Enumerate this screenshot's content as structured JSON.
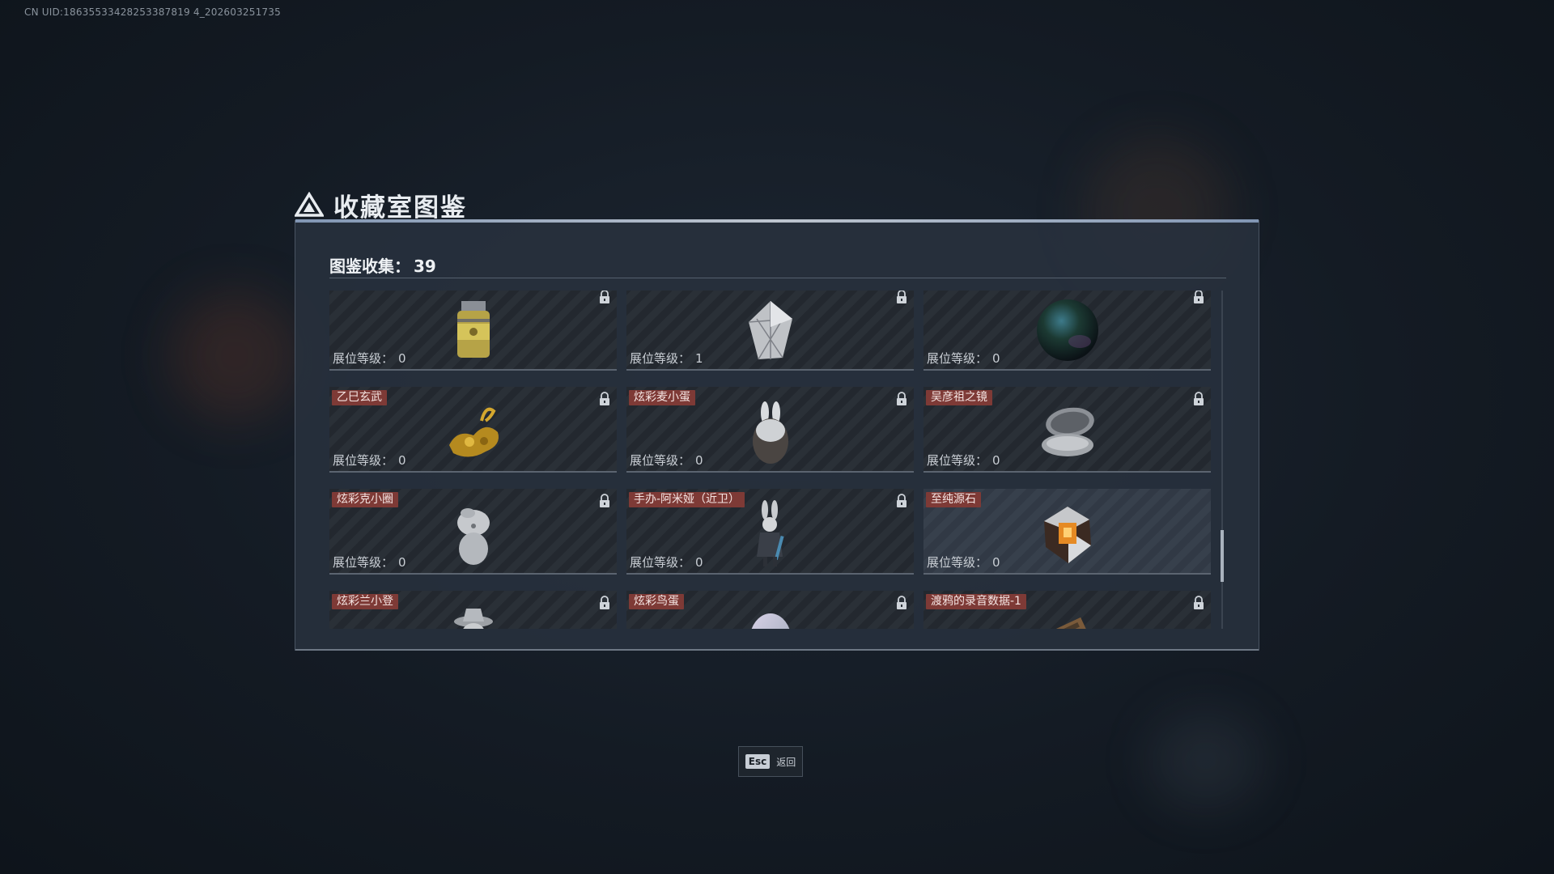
{
  "uid_text": "CN UID:18635533428253387819 4_202603251735",
  "window": {
    "title": "收藏室图鉴"
  },
  "collection": {
    "label": "图鉴收集：",
    "count": "39"
  },
  "cards": [
    {
      "name": "",
      "level_label": "展位等级：",
      "level": "0",
      "icon": "fuel-canister-icon",
      "locked": true
    },
    {
      "name": "",
      "level_label": "展位等级：",
      "level": "1",
      "icon": "crystal-gem-icon",
      "locked": true
    },
    {
      "name": "",
      "level_label": "展位等级：",
      "level": "0",
      "icon": "dark-sphere-icon",
      "locked": true
    },
    {
      "name": "乙巳玄武",
      "level_label": "展位等级：",
      "level": "0",
      "icon": "golden-dragon-icon",
      "locked": true
    },
    {
      "name": "炫彩麦小蛋",
      "level_label": "展位等级：",
      "level": "0",
      "icon": "bunny-egg-figure-icon",
      "locked": true
    },
    {
      "name": "吴彦祖之镜",
      "level_label": "展位等级：",
      "level": "0",
      "icon": "compact-mirror-icon",
      "locked": true
    },
    {
      "name": "炫彩克小圈",
      "level_label": "展位等级：",
      "level": "0",
      "icon": "white-figurine-icon",
      "locked": true
    },
    {
      "name": "手办-阿米娅（近卫）",
      "level_label": "展位等级：",
      "level": "0",
      "icon": "amiya-figure-icon",
      "locked": true
    },
    {
      "name": "至纯源石",
      "level_label": "展位等级：",
      "level": "0",
      "icon": "originium-crystal-icon",
      "locked": false
    },
    {
      "name": "炫彩兰小登",
      "level_label": "",
      "level": "",
      "icon": "hat-figurine-icon",
      "locked": true
    },
    {
      "name": "炫彩鸟蛋",
      "level_label": "",
      "level": "",
      "icon": "bird-egg-icon",
      "locked": true
    },
    {
      "name": "渡鸦的录音数据-1",
      "level_label": "",
      "level": "",
      "icon": "recorder-device-icon",
      "locked": true
    }
  ],
  "footer": {
    "esc_key": "Esc",
    "esc_label": "返回"
  },
  "colors": {
    "tag_bg": "#7e3a36",
    "panel_bg": "#28313d",
    "accent_line": "#d6dde6"
  }
}
